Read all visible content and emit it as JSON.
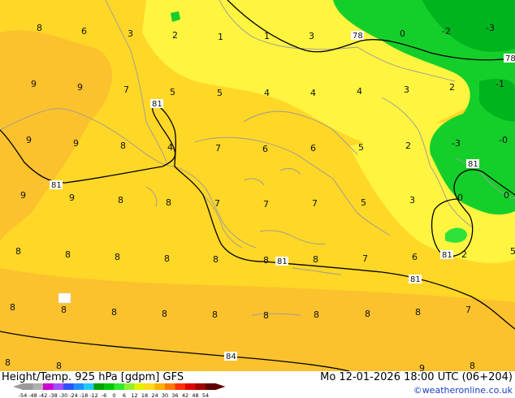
{
  "footer": {
    "title": "Height/Temp. 925 hPa [gdpm] GFS",
    "datetime": "Mo 12-01-2026 18:00 UTC (06+204)",
    "credit": "©weatheronline.co.uk"
  },
  "colorbar": {
    "ticks": [
      "-54",
      "-48",
      "-42",
      "-38",
      "-30",
      "-24",
      "-18",
      "-12",
      "-6",
      "0",
      "6",
      "12",
      "18",
      "24",
      "30",
      "36",
      "42",
      "48",
      "54"
    ],
    "colors": [
      "#9a9a9a",
      "#b0b0b0",
      "#d000d0",
      "#a050ff",
      "#3050ff",
      "#2090ff",
      "#20c8ff",
      "#00a000",
      "#00c800",
      "#30e830",
      "#90f030",
      "#e8f000",
      "#ffd820",
      "#ffb000",
      "#ff7800",
      "#ff3000",
      "#e00000",
      "#a00000",
      "#600000"
    ]
  },
  "map": {
    "colors": {
      "yellow_light": "#fff440",
      "yellow": "#ffd726",
      "yellow_dark": "#fcc22e",
      "green": "#14cf2a",
      "green_light": "#2ee23a",
      "green_dark": "#00b41e",
      "coast": "#9a9a9a",
      "contour": "#000000"
    },
    "contour_labels": [
      "78",
      "78",
      "81",
      "81",
      "81",
      "81",
      "81",
      "81",
      "84"
    ],
    "temperature_labels": [
      "8",
      "6",
      "3",
      "2",
      "1",
      "1",
      "3",
      "0",
      "-2",
      "-3",
      "9",
      "9",
      "7",
      "5",
      "5",
      "4",
      "4",
      "4",
      "3",
      "2",
      "-1",
      "9",
      "9",
      "8",
      "4",
      "7",
      "6",
      "6",
      "5",
      "2",
      "-3",
      "-0",
      "9",
      "9",
      "8",
      "8",
      "7",
      "7",
      "7",
      "5",
      "3",
      "0",
      "0",
      "8",
      "8",
      "8",
      "8",
      "8",
      "8",
      "8",
      "7",
      "6",
      "2",
      "5",
      "8",
      "8",
      "8",
      "8",
      "8",
      "8",
      "8",
      "8",
      "8",
      "7",
      "8",
      "8",
      "9",
      "8"
    ]
  }
}
